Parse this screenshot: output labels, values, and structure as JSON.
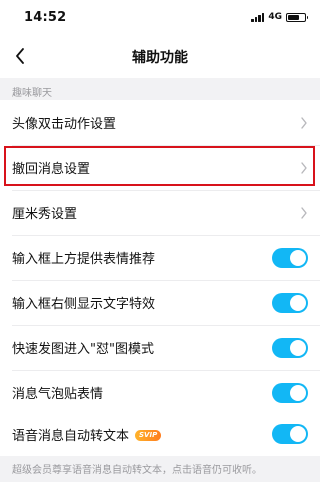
{
  "status_bar": {
    "time": "14:52",
    "network": "4G",
    "battery_level": 0.7
  },
  "nav": {
    "title": "辅助功能",
    "back_icon": "chevron-left-icon"
  },
  "section": {
    "title": "趣味聊天"
  },
  "items": [
    {
      "label": "头像双击动作设置",
      "control": "chevron"
    },
    {
      "label": "撤回消息设置",
      "control": "chevron",
      "highlighted": true
    },
    {
      "label": "厘米秀设置",
      "control": "chevron"
    },
    {
      "label": "输入框上方提供表情推荐",
      "control": "toggle",
      "on": true
    },
    {
      "label": "输入框右侧显示文字特效",
      "control": "toggle",
      "on": true
    },
    {
      "label": "快速发图进入\"怼\"图模式",
      "control": "toggle",
      "on": true
    },
    {
      "label": "消息气泡贴表情",
      "control": "toggle",
      "on": true
    }
  ],
  "voice": {
    "label": "语音消息自动转文本",
    "badge": "SVIP",
    "on": true,
    "note": "超级会员尊享语音消息自动转文本，点击语音仍可收听。"
  },
  "colors": {
    "toggle_on": "#12b7f5",
    "highlight_border": "#d8121b",
    "background": "#f2f2f4"
  }
}
